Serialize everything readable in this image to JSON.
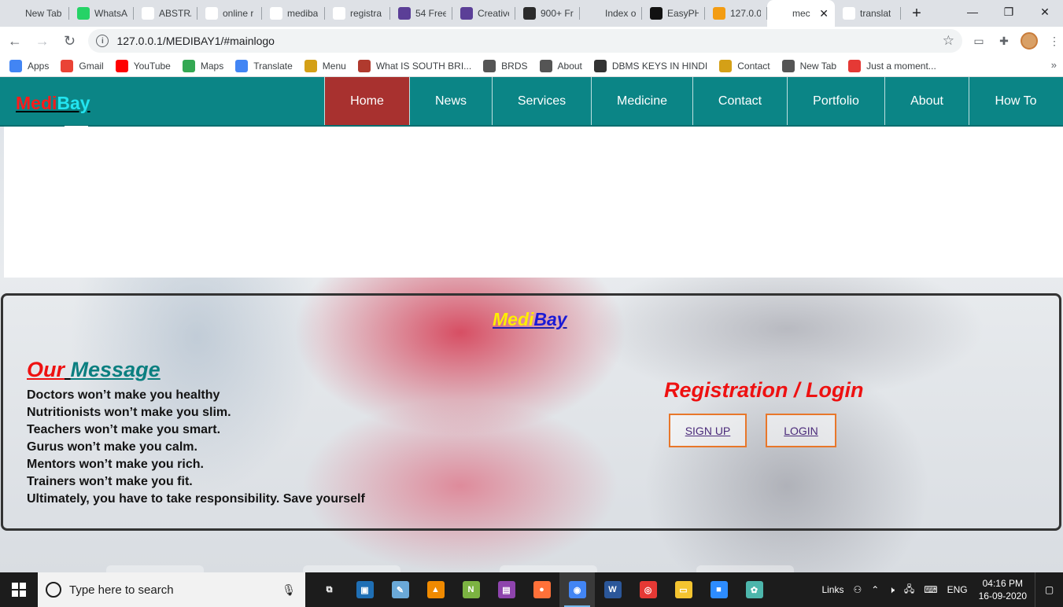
{
  "browser": {
    "tabs": [
      {
        "label": "New Tab",
        "icon": "newtab-icon",
        "width": 88,
        "color": "#dee1e6"
      },
      {
        "label": "WhatsA",
        "icon": "whatsapp-icon",
        "width": 82,
        "color": "#25d366"
      },
      {
        "label": "ABSTRA",
        "icon": "gmail-icon",
        "width": 81,
        "color": "#ffffff"
      },
      {
        "label": "online r",
        "icon": "google-icon",
        "width": 82,
        "color": "#ffffff"
      },
      {
        "label": "mediba",
        "icon": "medibay-favicon",
        "width": 80,
        "color": "#ffffff"
      },
      {
        "label": "registra",
        "icon": "google-icon",
        "width": 83,
        "color": "#ffffff"
      },
      {
        "label": "54 Free",
        "icon": "colorlib-icon",
        "width": 79,
        "color": "#5b3f97"
      },
      {
        "label": "Creative",
        "icon": "colorlib-icon",
        "width": 80,
        "color": "#5b3f97"
      },
      {
        "label": "900+ Fr",
        "icon": "w3-icon",
        "width": 82,
        "color": "#2b2b2b"
      },
      {
        "label": "Index o",
        "icon": "globe-icon",
        "width": 79,
        "color": "#dee1e6"
      },
      {
        "label": "EasyPH",
        "icon": "easyphp-icon",
        "width": 80,
        "color": "#111111"
      },
      {
        "label": "127.0.0.",
        "icon": "phpmyadmin-icon",
        "width": 79,
        "color": "#f39c12"
      },
      {
        "label": "mec",
        "icon": "medibay-favicon",
        "width": 86,
        "color": "#ffffff",
        "active": true
      },
      {
        "label": "translat",
        "icon": "google-icon",
        "width": 84,
        "color": "#ffffff"
      }
    ],
    "new_tab_symbol": "+",
    "close_symbol": "✕",
    "address": "127.0.0.1/MEDIBAY1/#mainlogo",
    "bookmarks": [
      {
        "label": "Apps",
        "icon": "apps-grid-icon"
      },
      {
        "label": "Gmail",
        "icon": "gmail-icon"
      },
      {
        "label": "YouTube",
        "icon": "youtube-icon"
      },
      {
        "label": "Maps",
        "icon": "maps-icon"
      },
      {
        "label": "Translate",
        "icon": "translate-icon"
      },
      {
        "label": "Menu",
        "icon": "medibay-favicon"
      },
      {
        "label": "What IS SOUTH BRI...",
        "icon": "image-icon"
      },
      {
        "label": "BRDS",
        "icon": "globe-icon"
      },
      {
        "label": "About",
        "icon": "globe-icon"
      },
      {
        "label": "DBMS KEYS IN HINDI",
        "icon": "link-icon"
      },
      {
        "label": "Contact",
        "icon": "medibay-favicon"
      },
      {
        "label": "New Tab",
        "icon": "globe-icon"
      },
      {
        "label": "Just a moment...",
        "icon": "loading-icon"
      }
    ],
    "more_bookmarks": "»"
  },
  "site": {
    "logo": {
      "part1": "Medi",
      "part2": "Bay"
    },
    "menu": [
      {
        "label": "Home",
        "active": true,
        "width": 108
      },
      {
        "label": "News",
        "width": 105
      },
      {
        "label": "Services",
        "width": 126
      },
      {
        "label": "Medicine",
        "width": 129
      },
      {
        "label": "Contact",
        "width": 120
      },
      {
        "label": "Portfolio",
        "width": 124
      },
      {
        "label": "About",
        "width": 107
      },
      {
        "label": "How To",
        "width": 119
      }
    ],
    "panel": {
      "logo": {
        "part1": "Medi",
        "part2": "Bay"
      },
      "message_title": {
        "part1": "Our",
        "part2": "Message"
      },
      "message_lines": [
        "Doctors won’t make you healthy",
        "Nutritionists won’t make you slim.",
        "Teachers won’t make you smart.",
        "Gurus won’t make you calm.",
        "Mentors won’t make you rich.",
        "Trainers won’t make you fit.",
        "Ultimately, you have to take responsibility. Save yourself"
      ],
      "registration_title": "Registration / Login",
      "signup_label": "SIGN UP",
      "login_label": "LOGIN"
    }
  },
  "taskbar": {
    "search_placeholder": "Type here to search",
    "apps": [
      {
        "name": "task-view-icon",
        "glyph": "⧉",
        "color": "#1c1c1c"
      },
      {
        "name": "remote-desktop-icon",
        "glyph": "▣",
        "color": "#1f6fb5"
      },
      {
        "name": "notepad-icon",
        "glyph": "✎",
        "color": "#6aa9d8"
      },
      {
        "name": "vlc-icon",
        "glyph": "▲",
        "color": "#f08a00"
      },
      {
        "name": "notepad-plus-icon",
        "glyph": "N",
        "color": "#7cb342"
      },
      {
        "name": "winrar-icon",
        "glyph": "▤",
        "color": "#8e44ad"
      },
      {
        "name": "firefox-icon",
        "glyph": "●",
        "color": "#ff7139"
      },
      {
        "name": "chrome-icon",
        "glyph": "◉",
        "color": "#4285f4",
        "active": true
      },
      {
        "name": "word-icon",
        "glyph": "W",
        "color": "#2b579a"
      },
      {
        "name": "screen-recorder-icon",
        "glyph": "◎",
        "color": "#e53935"
      },
      {
        "name": "file-explorer-icon",
        "glyph": "▭",
        "color": "#f4c430"
      },
      {
        "name": "zoom-icon",
        "glyph": "■",
        "color": "#2d8cff"
      },
      {
        "name": "paint-icon",
        "glyph": "✿",
        "color": "#4db6ac"
      }
    ],
    "tray_links": "Links",
    "language": "ENG",
    "time": "04:16 PM",
    "date": "16-09-2020"
  }
}
